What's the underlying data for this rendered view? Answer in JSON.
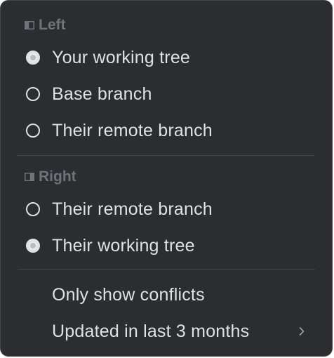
{
  "menu": {
    "left_section": {
      "header": "Left",
      "header_icon": "panel-left-icon",
      "options": [
        {
          "label": "Your working tree",
          "selected": true
        },
        {
          "label": "Base branch",
          "selected": false
        },
        {
          "label": "Their remote branch",
          "selected": false
        }
      ]
    },
    "right_section": {
      "header": "Right",
      "header_icon": "panel-right-icon",
      "options": [
        {
          "label": "Their remote branch",
          "selected": false
        },
        {
          "label": "Their working tree",
          "selected": true
        }
      ]
    },
    "filters": {
      "only_conflicts": "Only show conflicts",
      "updated": "Updated in last 3 months",
      "updated_icon": "chevron-right-icon"
    }
  },
  "colors": {
    "background": "#2b2d30",
    "text": "#dfe1e5",
    "header_text": "#6f737a",
    "separator": "#43454a"
  }
}
